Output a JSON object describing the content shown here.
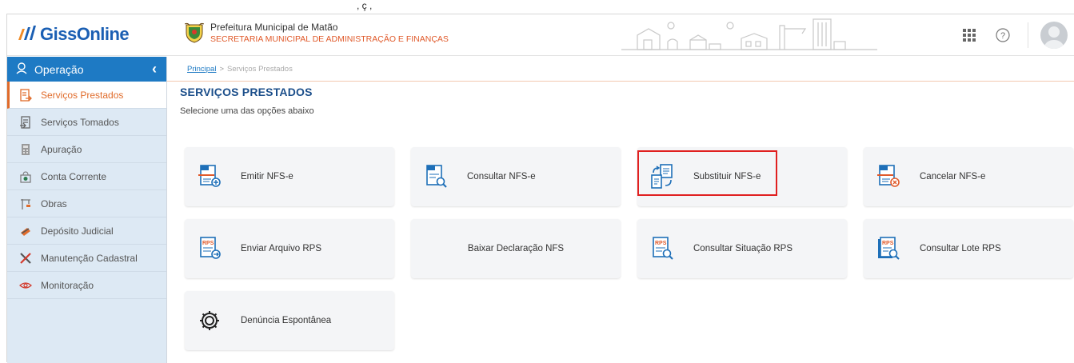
{
  "header": {
    "logo_text_1": "Giss",
    "logo_text_2": "Online",
    "pref_title": "Prefeitura Municipal de Matão",
    "pref_subtitle": "SECRETARIA MUNICIPAL DE ADMINISTRAÇÃO E FINANÇAS"
  },
  "sidebar": {
    "header_label": "Operação",
    "items": [
      {
        "label": "Serviços Prestados",
        "icon": "document-arrow-out-icon",
        "active": true
      },
      {
        "label": "Serviços Tomados",
        "icon": "document-arrow-in-icon"
      },
      {
        "label": "Apuração",
        "icon": "calculator-icon"
      },
      {
        "label": "Conta Corrente",
        "icon": "money-bag-icon"
      },
      {
        "label": "Obras",
        "icon": "crane-icon"
      },
      {
        "label": "Depósito Judicial",
        "icon": "gavel-icon"
      },
      {
        "label": "Manutenção Cadastral",
        "icon": "tools-icon"
      },
      {
        "label": "Monitoração",
        "icon": "eye-icon"
      }
    ]
  },
  "breadcrumb": {
    "home": "Principal",
    "separator": ">",
    "current": "Serviços Prestados"
  },
  "main": {
    "title": "SERVIÇOS PRESTADOS",
    "subtitle": "Selecione uma das opções abaixo",
    "cards": [
      {
        "label": "Emitir NFS-e",
        "icon": "nfse-emit-icon"
      },
      {
        "label": "Consultar NFS-e",
        "icon": "nfse-search-icon"
      },
      {
        "label": "Substituir NFS-e",
        "icon": "nfse-replace-icon"
      },
      {
        "label": "Cancelar NFS-e",
        "icon": "nfse-cancel-icon"
      },
      {
        "label": "Enviar Arquivo RPS",
        "icon": "rps-send-icon"
      },
      {
        "label": "Baixar Declaração NFS",
        "icon": ""
      },
      {
        "label": "Consultar Situação RPS",
        "icon": "rps-search-icon"
      },
      {
        "label": "Consultar Lote RPS",
        "icon": "rps-batch-search-icon"
      },
      {
        "label": "Denúncia Espontânea",
        "icon": "gear-icon"
      }
    ]
  },
  "colors": {
    "accent_blue": "#1e7ac4",
    "accent_orange": "#e06b2a",
    "highlight_red": "#e02020"
  },
  "partial_top_text": ", ç ,"
}
